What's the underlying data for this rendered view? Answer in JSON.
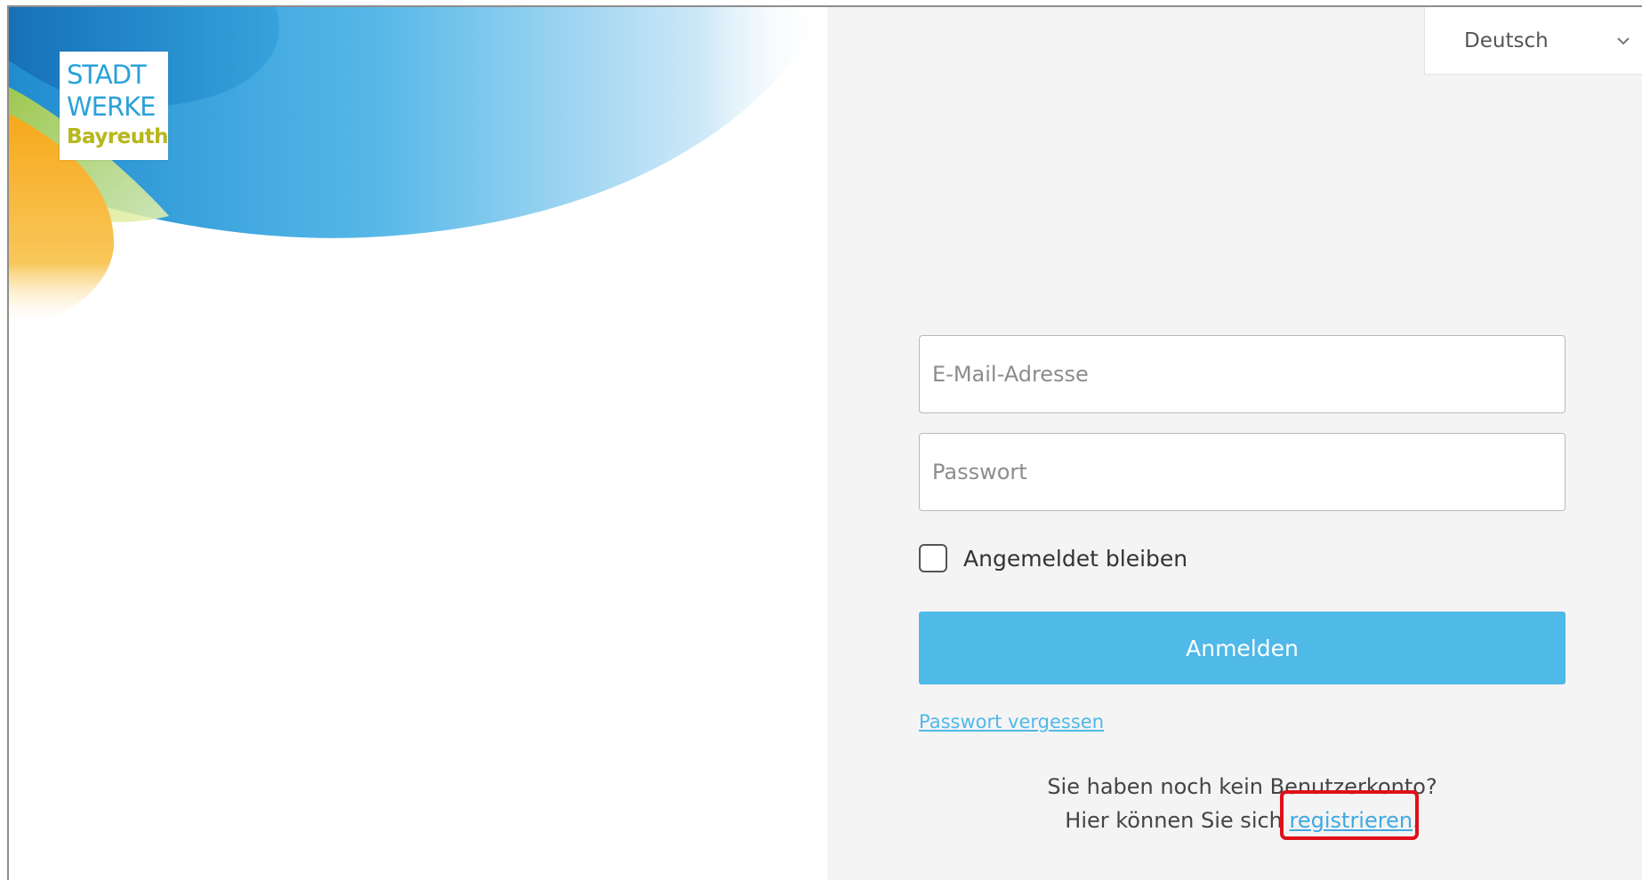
{
  "brand": {
    "logo_line1": "STADT",
    "logo_line2": "WERKE",
    "logo_line3": "Bayreuth",
    "colors": {
      "blue": "#2aa2d8",
      "green": "#a6c91a",
      "yellow": "#f8b81e",
      "accent": "#4fb9e8"
    }
  },
  "language": {
    "selected": "Deutsch",
    "icon": "chevron-down-icon"
  },
  "login": {
    "email_placeholder": "E-Mail-Adresse",
    "password_placeholder": "Passwort",
    "remember_label": "Angemeldet bleiben",
    "submit_label": "Anmelden",
    "forgot_label": "Passwort vergessen"
  },
  "register": {
    "question": "Sie haben noch kein Benutzerkonto?",
    "prefix": "Hier können Sie sich ",
    "link_label": "registrieren",
    "suffix": "."
  },
  "annotation": {
    "highlight_color": "#e0101a"
  }
}
